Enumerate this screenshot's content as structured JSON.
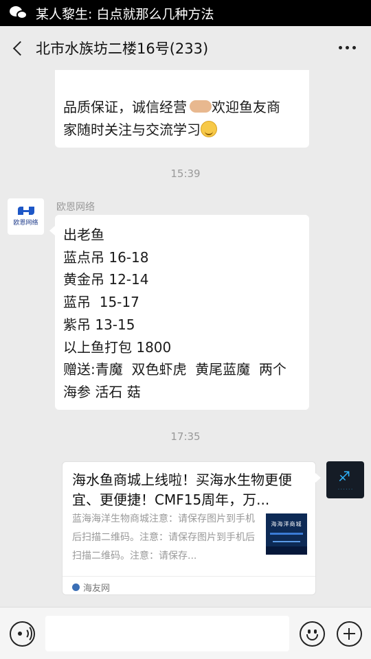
{
  "notification": {
    "icon": "wechat-icon",
    "text": "某人黎生: 白点就那么几种方法"
  },
  "header": {
    "title": "北市水族坊二楼16号(233)",
    "back_icon": "chevron-left-icon",
    "more_icon": "more-dots-icon"
  },
  "messages": {
    "top_bubble": {
      "line1": "品质保证，诚信经营",
      "line1_after": "欢迎鱼友商",
      "line2": "家随时关注与交流学习"
    },
    "time1": "15:39",
    "fish_message": {
      "sender": "欧恩网络",
      "avatar_caption": "欧恩网络",
      "lines": [
        "出老鱼",
        "蓝点吊 16-18",
        "黄金吊 12-14",
        "蓝吊  15-17",
        "紫吊 13-15",
        "以上鱼打包 1800",
        "赠送:青魔  双色虾虎  黄尾蓝魔  两个",
        "海参 活石 菇"
      ]
    },
    "time2": "17:35",
    "link_card": {
      "title": "海水鱼商城上线啦！买海水生物更便宜、更便捷！CMF15周年，万...",
      "description": "蓝海海洋生物商城注意：请保存图片到手机后扫描二维码。注意：请保存图片到手机后扫描二维码。注意：请保存...",
      "thumbnail_text": "海海洋商城",
      "source": "海友网"
    }
  },
  "input_bar": {
    "voice_icon": "voice-icon",
    "emoji_icon": "emoji-icon",
    "plus_icon": "plus-icon"
  },
  "colors": {
    "background": "#ebebeb",
    "bubble": "#ffffff",
    "timestamp": "#999999",
    "brand_blue": "#1d57c7"
  }
}
